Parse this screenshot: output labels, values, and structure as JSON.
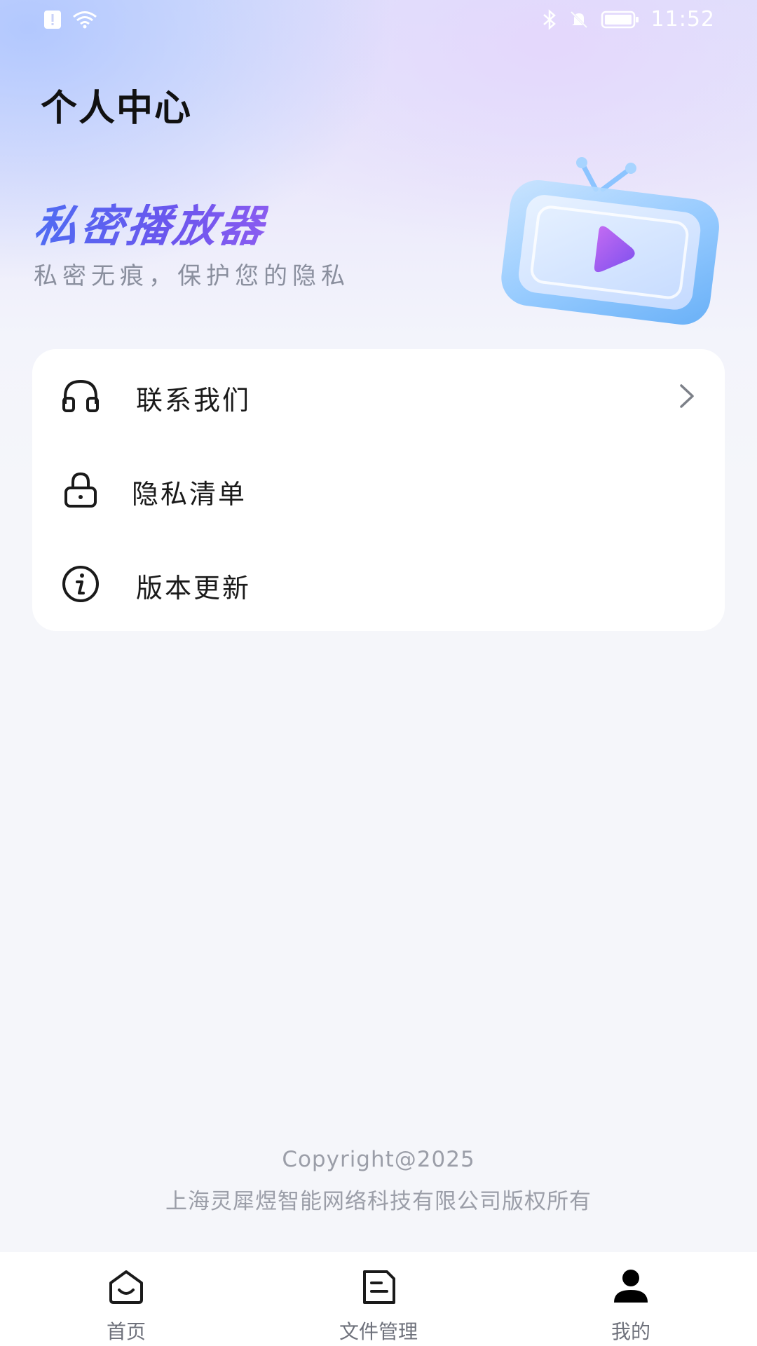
{
  "status_bar": {
    "time": "11:52"
  },
  "header": {
    "title": "个人中心",
    "brand_name": "私密播放器",
    "slogan": "私密无痕，保护您的隐私"
  },
  "menu": {
    "items": [
      {
        "label": "联系我们",
        "icon": "headset-icon",
        "has_chevron": true
      },
      {
        "label": "隐私清单",
        "icon": "lock-icon",
        "has_chevron": false
      },
      {
        "label": "版本更新",
        "icon": "info-icon",
        "has_chevron": false
      }
    ]
  },
  "footer": {
    "copyright": "Copyright@2025",
    "company": "上海灵犀煜智能网络科技有限公司版权所有"
  },
  "bottom_nav": {
    "tabs": [
      {
        "label": "首页",
        "icon": "home-icon",
        "active": false
      },
      {
        "label": "文件管理",
        "icon": "file-icon",
        "active": false
      },
      {
        "label": "我的",
        "icon": "profile-icon",
        "active": true
      }
    ]
  },
  "colors": {
    "brand_gradient_start": "#4f6cf2",
    "brand_gradient_end": "#8a5cf0",
    "active_tab": "#000000",
    "inactive_tab": "#6e717b"
  }
}
